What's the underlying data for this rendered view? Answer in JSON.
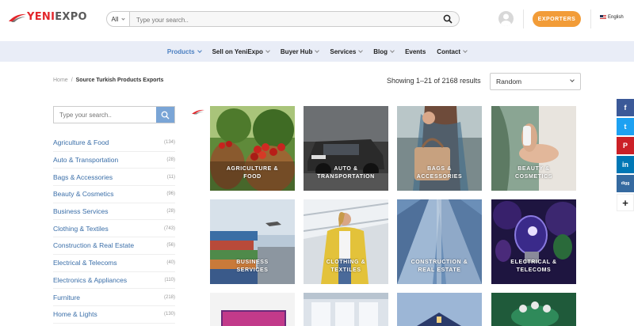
{
  "header": {
    "logo_part1": "YENI",
    "logo_part2": "EXPO",
    "category_select": "All",
    "search_placeholder": "Type your search..",
    "exporters_label": "EXPORTERS",
    "language": "English"
  },
  "nav": {
    "items": [
      {
        "label": "Products",
        "active": true,
        "dropdown": true
      },
      {
        "label": "Sell on YeniExpo",
        "active": false,
        "dropdown": true
      },
      {
        "label": "Buyer Hub",
        "active": false,
        "dropdown": true
      },
      {
        "label": "Services",
        "active": false,
        "dropdown": true
      },
      {
        "label": "Blog",
        "active": false,
        "dropdown": true
      },
      {
        "label": "Events",
        "active": false,
        "dropdown": false
      },
      {
        "label": "Contact",
        "active": false,
        "dropdown": true
      }
    ]
  },
  "breadcrumb": {
    "home": "Home",
    "separator": "/",
    "current": "Source Turkish Products Exports"
  },
  "results": {
    "text": "Showing 1–21 of 2168 results",
    "sort_value": "Random"
  },
  "sidebar": {
    "search_placeholder": "Type your search..",
    "categories": [
      {
        "name": "Agriculture & Food",
        "count": "(134)"
      },
      {
        "name": "Auto & Transportation",
        "count": "(28)"
      },
      {
        "name": "Bags & Accessories",
        "count": "(11)"
      },
      {
        "name": "Beauty & Cosmetics",
        "count": "(96)"
      },
      {
        "name": "Business Services",
        "count": "(28)"
      },
      {
        "name": "Clothing & Textiles",
        "count": "(743)"
      },
      {
        "name": "Construction & Real Estate",
        "count": "(56)"
      },
      {
        "name": "Electrical & Telecoms",
        "count": "(40)"
      },
      {
        "name": "Electronics & Appliances",
        "count": "(110)"
      },
      {
        "name": "Furniture",
        "count": "(218)"
      },
      {
        "name": "Home & Lights",
        "count": "(130)"
      }
    ]
  },
  "grid": {
    "tiles": [
      {
        "line1": "AGRICULTURE &",
        "line2": "FOOD"
      },
      {
        "line1": "AUTO &",
        "line2": "TRANSPORTATION"
      },
      {
        "line1": "BAGS &",
        "line2": "ACCESSORIES"
      },
      {
        "line1": "BEAUTY &",
        "line2": "COSMETICS"
      },
      {
        "line1": "BUSINESS",
        "line2": "SERVICES"
      },
      {
        "line1": "CLOTHING &",
        "line2": "TEXTILES"
      },
      {
        "line1": "CONSTRUCTION &",
        "line2": "REAL ESTATE"
      },
      {
        "line1": "ELECTRICAL &",
        "line2": "TELECOMS"
      },
      {
        "line1": "",
        "line2": ""
      },
      {
        "line1": "",
        "line2": ""
      },
      {
        "line1": "",
        "line2": ""
      },
      {
        "line1": "",
        "line2": ""
      }
    ]
  },
  "share": {
    "icons": [
      "facebook-icon",
      "twitter-icon",
      "pinterest-icon",
      "linkedin-icon",
      "digg-icon",
      "plus-icon"
    ],
    "colors": [
      "#3b5998",
      "#1da1f2",
      "#cb2027",
      "#0077b5",
      "#356aa0",
      "#ffffff"
    ],
    "glyphs": [
      "f",
      "t",
      "P",
      "in",
      "digg",
      "+"
    ]
  },
  "colors": {
    "accent": "#f29c38",
    "link": "#3a6ea8",
    "nav_bg": "#e9edf7",
    "active_nav": "#4a7fc1",
    "brand_red": "#e3262b"
  }
}
